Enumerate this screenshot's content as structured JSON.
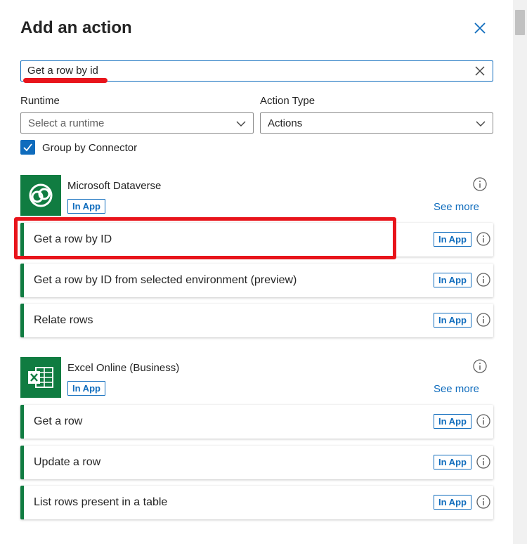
{
  "header": {
    "title": "Add an action"
  },
  "search": {
    "value": "Get a row by id"
  },
  "filters": {
    "runtime_label": "Runtime",
    "runtime_placeholder": "Select a runtime",
    "action_type_label": "Action Type",
    "action_type_value": "Actions",
    "group_by_label": "Group by Connector",
    "group_by_checked": true
  },
  "colors": {
    "accent": "#0f6cbd",
    "connector_green": "#107c41",
    "highlight_red": "#e8141b"
  },
  "connectors": [
    {
      "name": "Microsoft Dataverse",
      "icon": "dataverse-icon",
      "badge": "In App",
      "see_more": "See more",
      "actions": [
        {
          "name": "Get a row by ID",
          "badge": "In App"
        },
        {
          "name": "Get a row by ID from selected environment (preview)",
          "badge": "In App"
        },
        {
          "name": "Relate rows",
          "badge": "In App"
        }
      ]
    },
    {
      "name": "Excel Online (Business)",
      "icon": "excel-icon",
      "badge": "In App",
      "see_more": "See more",
      "actions": [
        {
          "name": "Get a row",
          "badge": "In App"
        },
        {
          "name": "Update a row",
          "badge": "In App"
        },
        {
          "name": "List rows present in a table",
          "badge": "In App"
        }
      ]
    }
  ]
}
